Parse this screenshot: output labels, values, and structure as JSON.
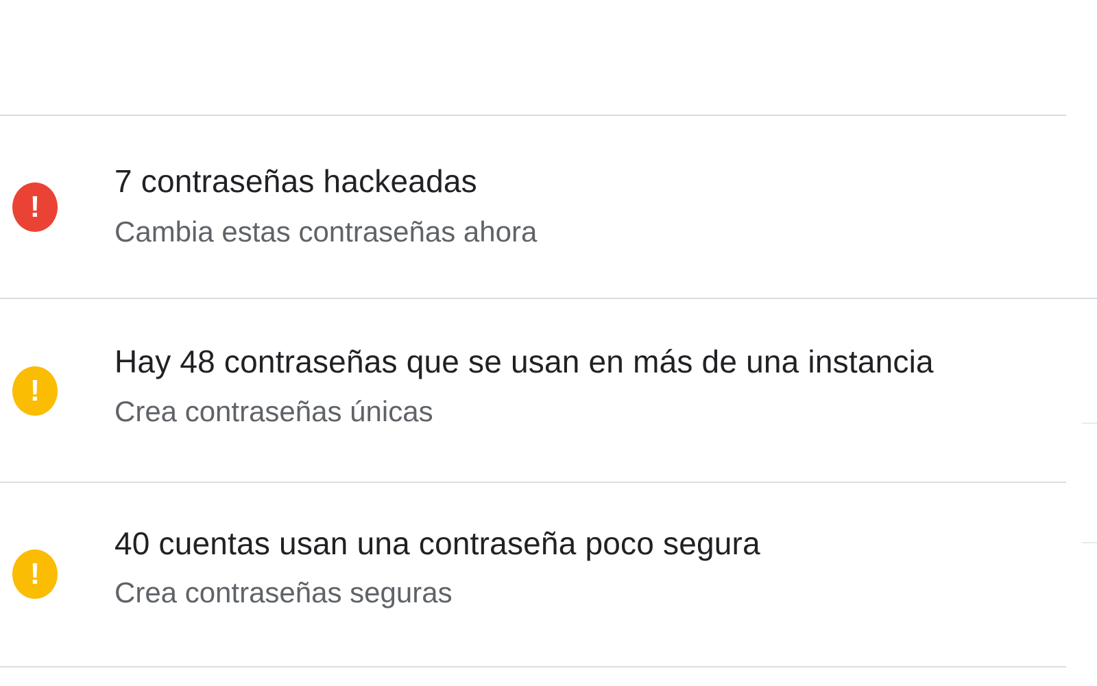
{
  "colors": {
    "danger": "#ea4335",
    "warning": "#fbbc04",
    "divider": "#dadce0",
    "title_text": "#202124",
    "subtitle_text": "#5f6368"
  },
  "issues": [
    {
      "severity": "danger",
      "icon": "exclamation-circle-icon",
      "icon_glyph": "!",
      "title": "7 contraseñas hackeadas",
      "subtitle": "Cambia estas contraseñas ahora"
    },
    {
      "severity": "warning",
      "icon": "exclamation-circle-icon",
      "icon_glyph": "!",
      "title": "Hay 48 contraseñas que se usan en más de una instancia",
      "subtitle": "Crea contraseñas únicas"
    },
    {
      "severity": "warning",
      "icon": "exclamation-circle-icon",
      "icon_glyph": "!",
      "title": "40 cuentas usan una contraseña poco segura",
      "subtitle": "Crea contraseñas seguras"
    }
  ]
}
